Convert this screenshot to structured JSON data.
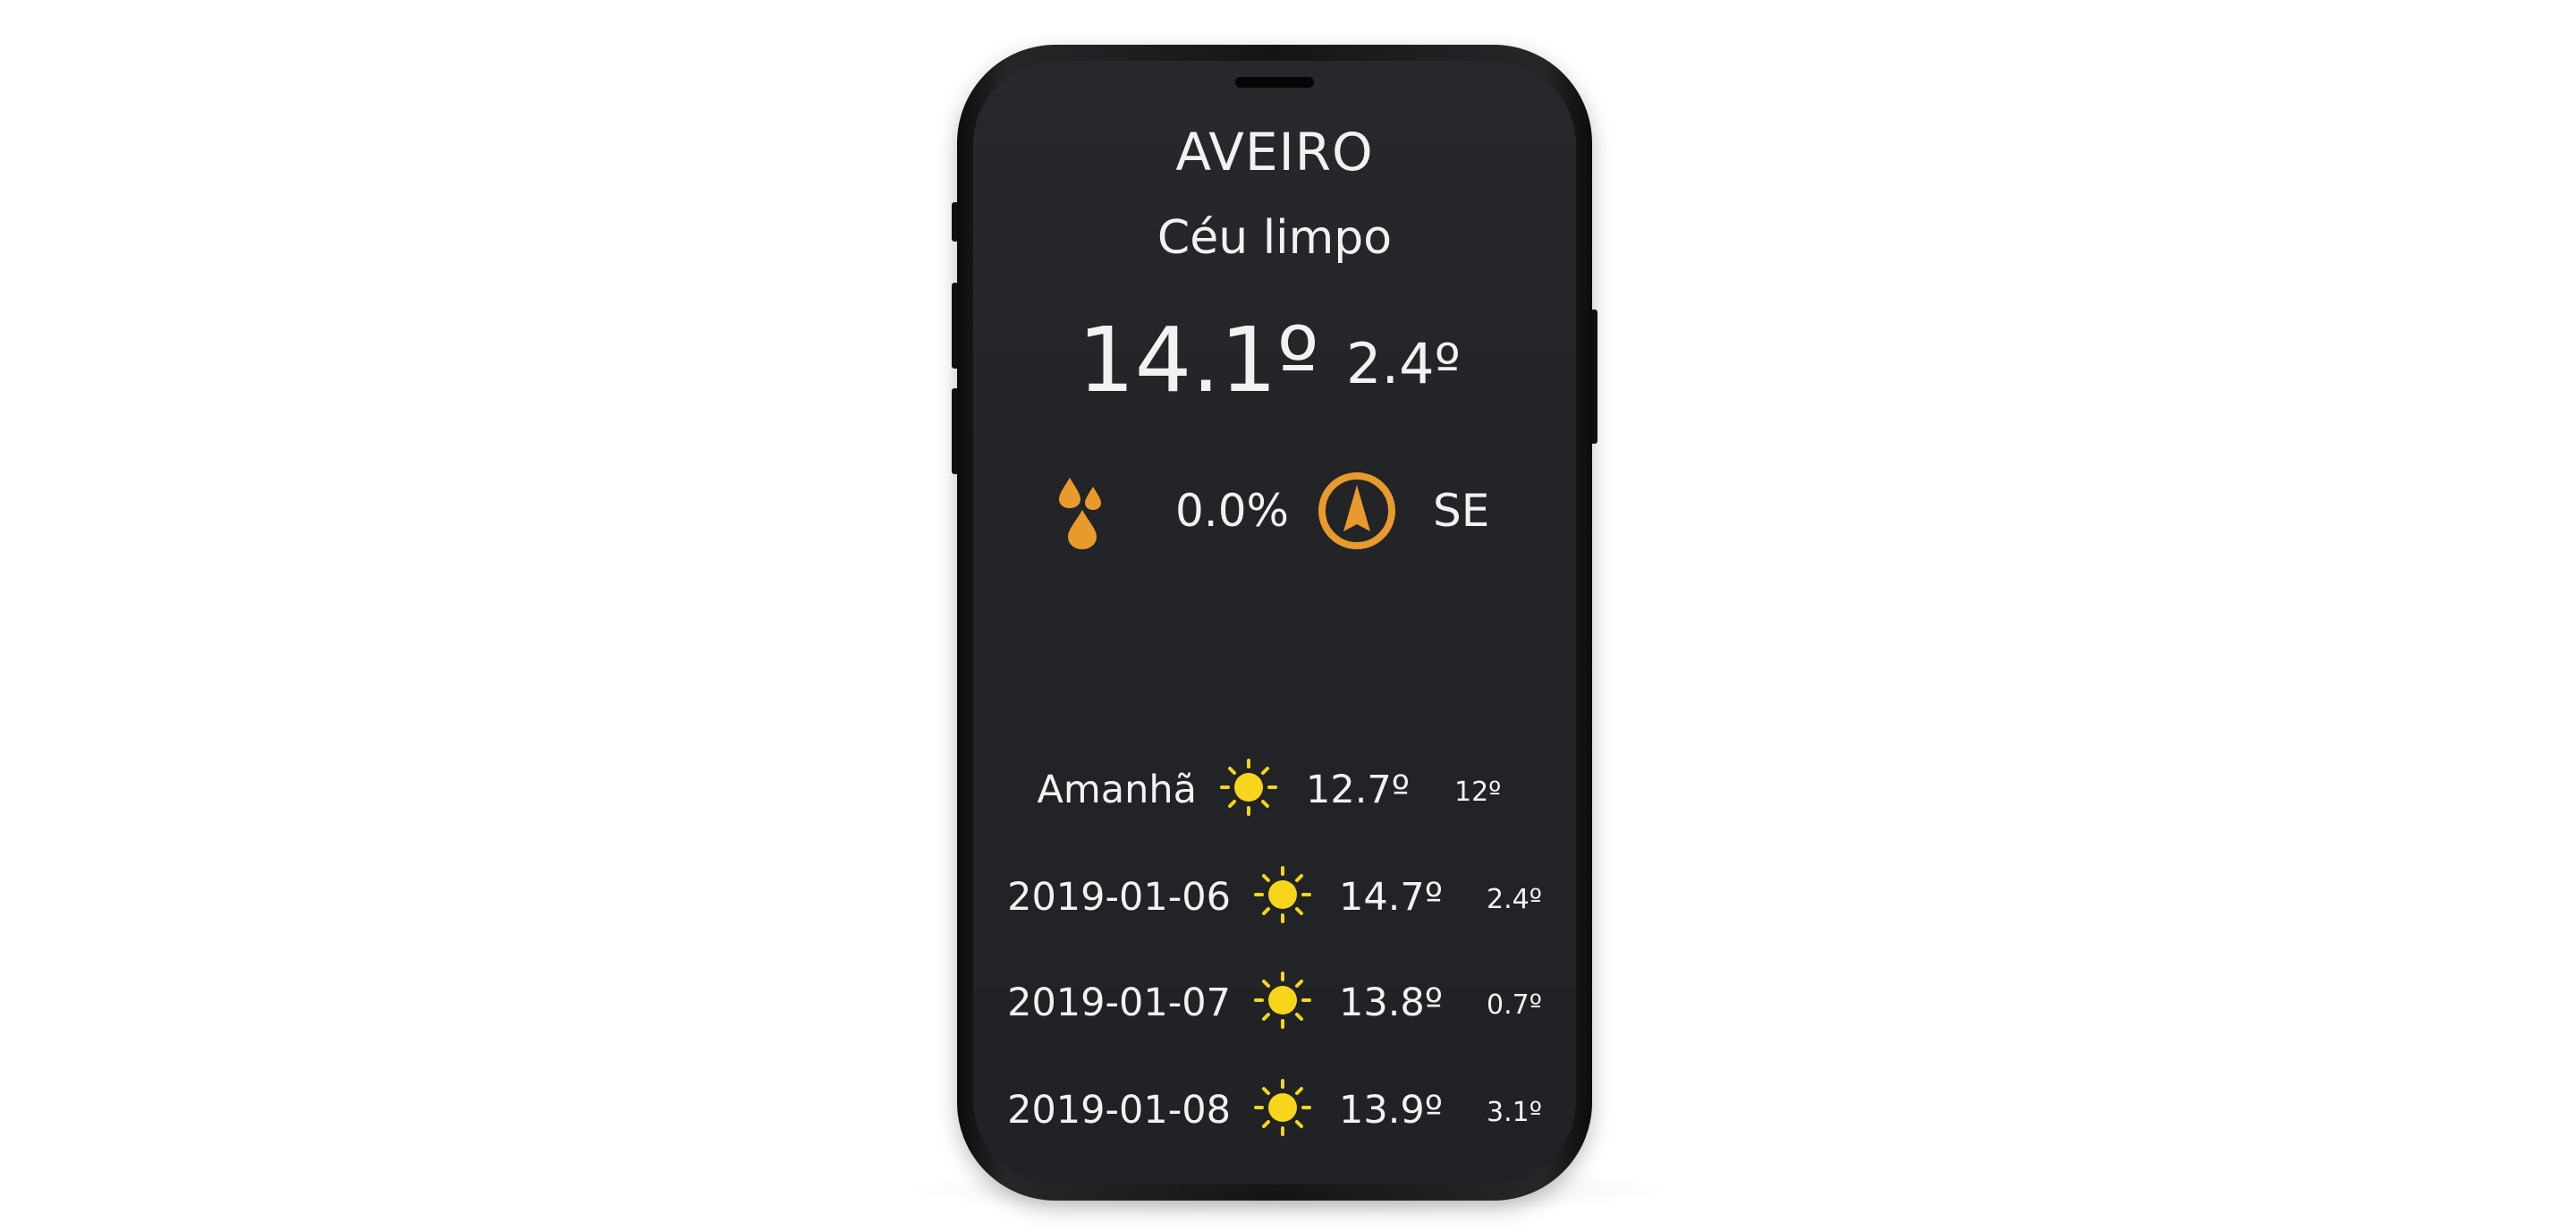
{
  "location": {
    "city": "AVEIRO",
    "condition": "Céu limpo"
  },
  "current": {
    "temp_max": "14.1º",
    "temp_min": "2.4º",
    "precipitation": "0.0%",
    "wind_direction": "SE",
    "precip_icon": "raindrops-icon",
    "wind_icon": "compass-arrow-icon"
  },
  "forecast": [
    {
      "day": "Amanhã",
      "max": "12.7º",
      "min": "12º",
      "icon": "sun-icon"
    },
    {
      "day": "2019-01-06",
      "max": "14.7º",
      "min": "2.4º",
      "icon": "sun-icon"
    },
    {
      "day": "2019-01-07",
      "max": "13.8º",
      "min": "0.7º",
      "icon": "sun-icon"
    },
    {
      "day": "2019-01-08",
      "max": "13.9º",
      "min": "3.1º",
      "icon": "sun-icon"
    }
  ],
  "colors": {
    "background": "#ffffff",
    "screen": "#222428",
    "text": "#f2f2f2",
    "accent_orange": "#e89a2c",
    "sun_yellow": "#f7d51a"
  }
}
